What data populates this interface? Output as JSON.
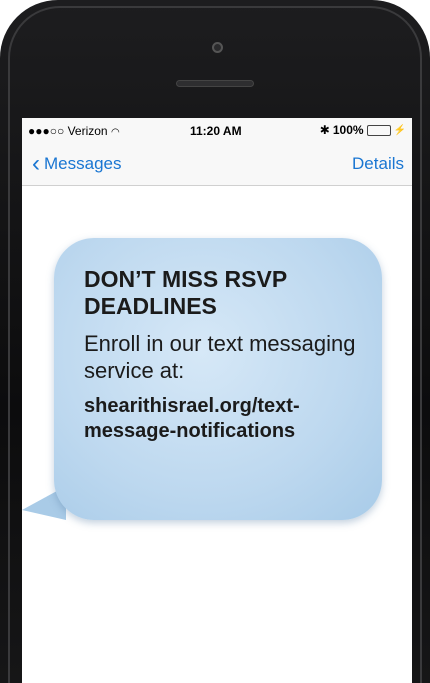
{
  "status": {
    "carrier": "●●●○○ Verizon",
    "wifi": "▲",
    "time": "11:20 AM",
    "bluetooth": "✳",
    "battery": "100%",
    "battery_level": 1.0
  },
  "nav": {
    "back_label": "Messages",
    "details_label": "Details"
  },
  "message": {
    "headline": "DON’T MISS RSVP DEADLINES",
    "body": "Enroll in our text messaging service at:",
    "link": "shearithisrael.org/text-message-notifications"
  },
  "colors": {
    "accent": "#1a76d2",
    "bubble": "#bdd8ef",
    "battery": "#4cd964"
  }
}
